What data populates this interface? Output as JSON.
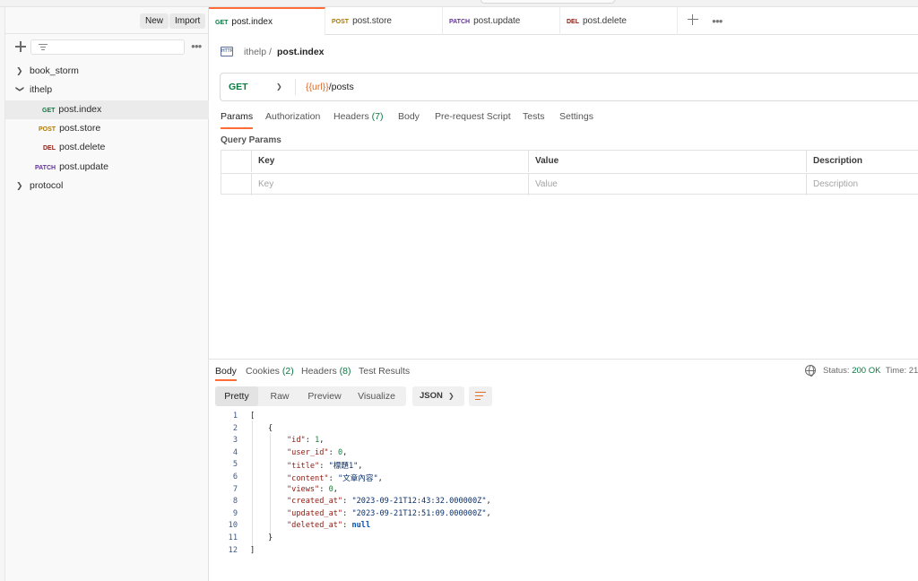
{
  "sidebar": {
    "new_label": "New",
    "import_label": "Import",
    "collections": [
      {
        "name": "book_storm",
        "expanded": false
      },
      {
        "name": "ithelp",
        "expanded": true,
        "requests": [
          {
            "method": "GET",
            "name": "post.index",
            "active": true
          },
          {
            "method": "POST",
            "name": "post.store"
          },
          {
            "method": "DEL",
            "name": "post.delete"
          },
          {
            "method": "PATCH",
            "name": "post.update"
          }
        ]
      },
      {
        "name": "protocol",
        "expanded": false
      }
    ]
  },
  "tabs": [
    {
      "method": "GET",
      "name": "post.index",
      "active": true
    },
    {
      "method": "POST",
      "name": "post.store"
    },
    {
      "method": "PATCH",
      "name": "post.update"
    },
    {
      "method": "DEL",
      "name": "post.delete"
    }
  ],
  "breadcrumb": {
    "parent": "ithelp",
    "separator": "/",
    "current": "post.index",
    "icon": "http-icon"
  },
  "request": {
    "method": "GET",
    "url_var": "{{url}}",
    "url_path": "/posts"
  },
  "request_tabs": [
    {
      "label": "Params",
      "active": true
    },
    {
      "label": "Authorization"
    },
    {
      "label": "Headers",
      "count": "(7)"
    },
    {
      "label": "Body"
    },
    {
      "label": "Pre-request Script"
    },
    {
      "label": "Tests"
    },
    {
      "label": "Settings"
    }
  ],
  "query_params": {
    "title": "Query Params",
    "headers": [
      "Key",
      "Value",
      "Description"
    ],
    "placeholders": [
      "Key",
      "Value",
      "Description"
    ]
  },
  "response": {
    "tabs": [
      {
        "label": "Body",
        "active": true
      },
      {
        "label": "Cookies",
        "count": "(2)"
      },
      {
        "label": "Headers",
        "count": "(8)"
      },
      {
        "label": "Test Results"
      }
    ],
    "status_label": "Status:",
    "status_value": "200 OK",
    "time_label": "Time: 21",
    "views": [
      "Pretty",
      "Raw",
      "Preview",
      "Visualize"
    ],
    "format": "JSON",
    "line_numbers": [
      "1",
      "2",
      "3",
      "4",
      "5",
      "6",
      "7",
      "8",
      "9",
      "10",
      "11",
      "12"
    ],
    "body": {
      "open_bracket": "[",
      "open_brace": "{",
      "fields": [
        {
          "key": "\"id\"",
          "value": "1",
          "type": "number",
          "comma": ","
        },
        {
          "key": "\"user_id\"",
          "value": "0",
          "type": "number",
          "comma": ","
        },
        {
          "key": "\"title\"",
          "value": "\"標題1\"",
          "type": "string",
          "comma": ","
        },
        {
          "key": "\"content\"",
          "value": "\"文章內容\"",
          "type": "string",
          "comma": ","
        },
        {
          "key": "\"views\"",
          "value": "0",
          "type": "number",
          "comma": ","
        },
        {
          "key": "\"created_at\"",
          "value": "\"2023-09-21T12:43:32.000000Z\"",
          "type": "string",
          "comma": ","
        },
        {
          "key": "\"updated_at\"",
          "value": "\"2023-09-21T12:51:09.000000Z\"",
          "type": "string",
          "comma": ","
        },
        {
          "key": "\"deleted_at\"",
          "value": "null",
          "type": "null",
          "comma": ""
        }
      ],
      "close_brace": "}",
      "close_bracket": "]"
    }
  },
  "colors": {
    "accent": "#ff6c37",
    "get": "#0c7a43",
    "post": "#ad7a03",
    "delete": "#8e1a10",
    "patch": "#623497"
  }
}
